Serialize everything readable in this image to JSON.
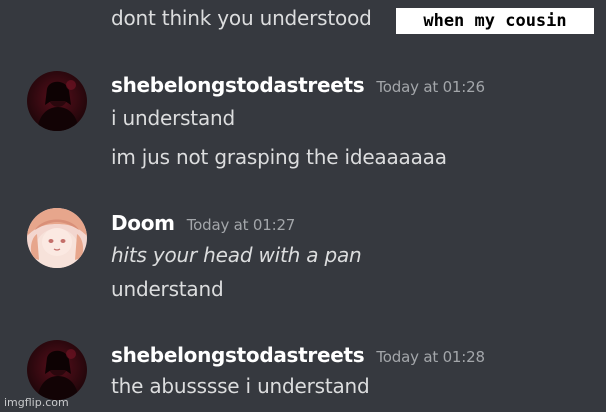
{
  "caption": "when my cousin",
  "watermark": "imgflip.com",
  "colors": {
    "background": "#36393f",
    "message_text": "#dcddde",
    "username": "#ffffff",
    "timestamp": "#a3a6aa"
  },
  "messages": [
    {
      "continuation_text": "dont think you understood"
    },
    {
      "username": "shebelongstodastreets",
      "timestamp": "Today at 01:26",
      "avatar_icon": "dark-red-portrait-avatar",
      "lines": [
        "i understand",
        "im jus not grasping the ideaaaaaa"
      ]
    },
    {
      "username": "Doom",
      "timestamp": "Today at 01:27",
      "avatar_icon": "pink-anime-girl-avatar",
      "lines": [
        "hits your head with a pan",
        "understand"
      ]
    },
    {
      "username": "shebelongstodastreets",
      "timestamp": "Today at 01:28",
      "avatar_icon": "dark-red-portrait-avatar",
      "lines": [
        "the abusssse i understand"
      ]
    }
  ]
}
